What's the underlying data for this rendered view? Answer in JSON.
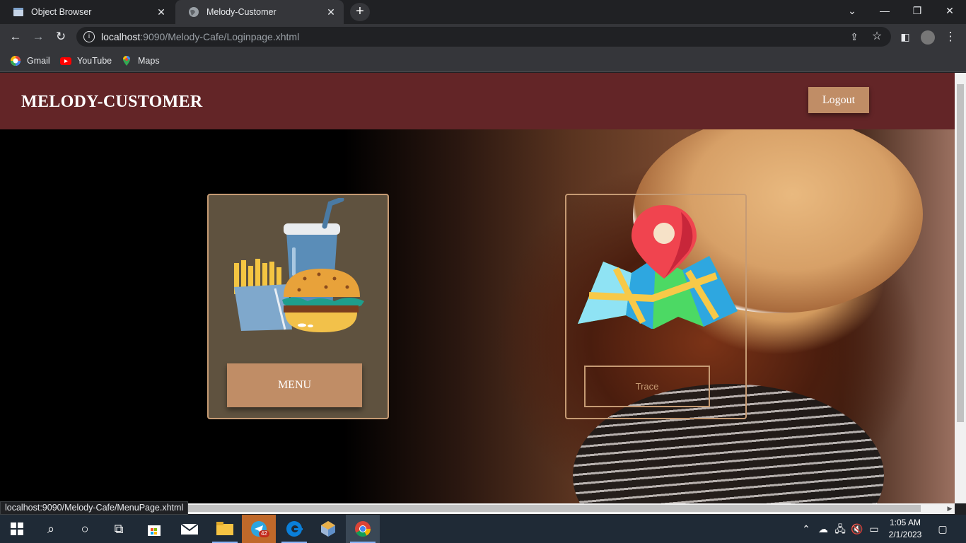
{
  "browser": {
    "tabs": [
      {
        "label": "Object Browser"
      },
      {
        "label": "Melody-Customer",
        "active": true
      }
    ],
    "url_host": "localhost",
    "url_path": ":9090/Melody-Cafe/Loginpage.xhtml",
    "bookmarks": [
      {
        "label": "Gmail"
      },
      {
        "label": "YouTube"
      },
      {
        "label": "Maps"
      }
    ],
    "status_url": "localhost:9090/Melody-Cafe/MenuPage.xhtml"
  },
  "page": {
    "brand": "MELODY-CUSTOMER",
    "logout_label": "Logout",
    "menu_label": "MENU",
    "trace_label": "Trace"
  },
  "colors": {
    "header": "#632527",
    "accent": "#c08d66",
    "card": "#5f523f",
    "border": "#c69b74"
  },
  "taskbar": {
    "apps": [
      "start-icon",
      "search-icon",
      "cortana-icon",
      "task-view-icon",
      "store-icon",
      "mail-icon",
      "file-explorer-icon",
      "telegram-icon",
      "edge-icon",
      "app-icon",
      "chrome-icon"
    ],
    "telegram_badge": "42",
    "time": "1:05 AM",
    "date": "2/1/2023"
  }
}
